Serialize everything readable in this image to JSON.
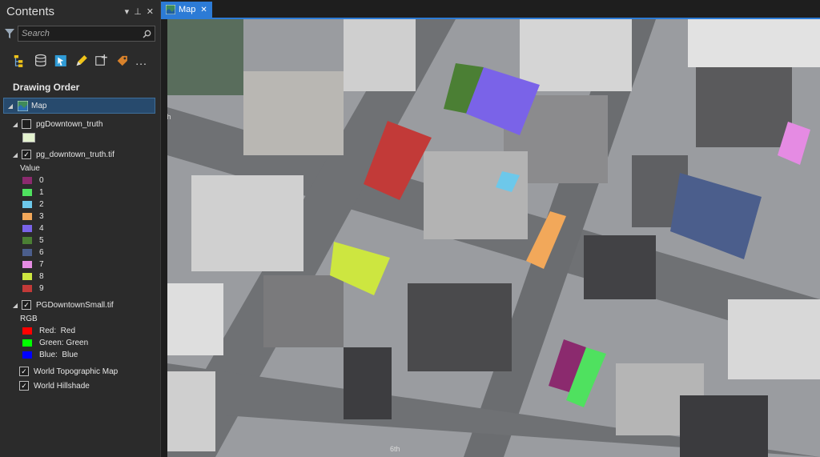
{
  "contents_pane": {
    "title": "Contents",
    "tools": {
      "menu": "▾",
      "pin": "⊥",
      "close": "✕"
    },
    "search_placeholder": "Search",
    "section_title": "Drawing Order",
    "more_label": "..."
  },
  "layers": {
    "map": "Map",
    "pg_truth": {
      "name": "pgDowntown_truth",
      "checked": false
    },
    "pg_truth_tif": {
      "name": "pg_downtown_truth.tif",
      "checked": true,
      "legend_title": "Value",
      "values": [
        {
          "label": "0",
          "color": "#8b2a6e"
        },
        {
          "label": "1",
          "color": "#4fe15f"
        },
        {
          "label": "2",
          "color": "#6dc8ea"
        },
        {
          "label": "3",
          "color": "#f2a85a"
        },
        {
          "label": "4",
          "color": "#7a63e8"
        },
        {
          "label": "5",
          "color": "#4b7f34"
        },
        {
          "label": "6",
          "color": "#4b5e8c"
        },
        {
          "label": "7",
          "color": "#e58be3"
        },
        {
          "label": "8",
          "color": "#cde640"
        },
        {
          "label": "9",
          "color": "#c23a38"
        }
      ]
    },
    "small_tif": {
      "name": "PGDowntownSmall.tif",
      "checked": true,
      "legend_title": "RGB",
      "bands": [
        {
          "label": "Red:  Red",
          "color": "#ff0000"
        },
        {
          "label": "Green: Green",
          "color": "#00ff00"
        },
        {
          "label": "Blue:  Blue",
          "color": "#0000ff"
        }
      ]
    },
    "topo": {
      "name": "World Topographic Map",
      "checked": true
    },
    "hillshade": {
      "name": "World Hillshade",
      "checked": true
    }
  },
  "map_tab": {
    "label": "Map",
    "close": "✕"
  },
  "map_labels": {
    "street_a": "6th",
    "street_b": "6th"
  }
}
